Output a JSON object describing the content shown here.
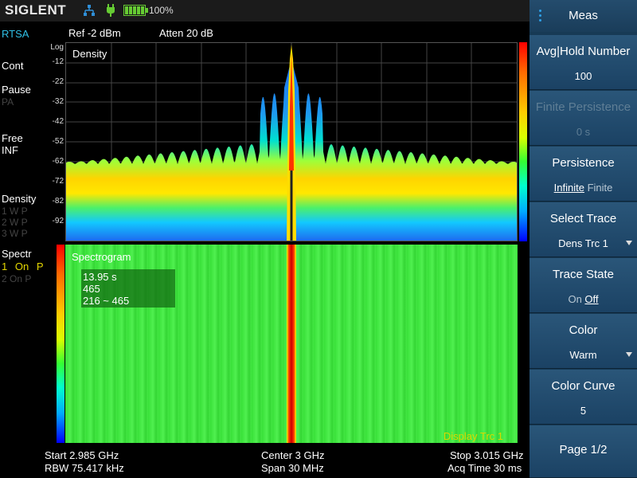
{
  "header": {
    "logo": "SIGLENT",
    "battery_percent": "100%",
    "icons": [
      "network-icon",
      "power-plug-icon",
      "battery-icon"
    ],
    "colors": {
      "logo": "#e8e8e8",
      "battery": "#66cc33",
      "network": "#2f8fd8"
    }
  },
  "left": {
    "mode": "RTSA",
    "sweep": "Cont",
    "pause": "Pause",
    "pause_sub": "PA",
    "free": "Free",
    "inf": "INF",
    "density": "Density",
    "density_traces": [
      "1 W P",
      "2 W P",
      "3 W P"
    ],
    "spectr": "Spectr",
    "spectr_trace_num": "1",
    "spectr_trace_on": "On",
    "spectr_trace_p": "P",
    "spectr_trace2": "2 On P"
  },
  "measurement": {
    "ref": "Ref  -2 dBm",
    "atten": "Atten   20 dB",
    "log_label": "Log",
    "y_ticks": [
      "-12",
      "-22",
      "-32",
      "-42",
      "-52",
      "-62",
      "-72",
      "-82",
      "-92"
    ]
  },
  "density": {
    "title": "Density"
  },
  "spectrogram": {
    "title": "Spectrogram",
    "info_time": "13.95 s",
    "info_count": "465",
    "info_range": "216 ~ 465",
    "display_trace": "Display Trc 1"
  },
  "footer": {
    "start": "Start  2.985 GHz",
    "rbw": "RBW  75.417 kHz",
    "center": "Center  3 GHz",
    "span": "Span  30 MHz",
    "stop": "Stop  3.015 GHz",
    "acq": "Acq Time   30 ms"
  },
  "menu": {
    "title": "Meas",
    "items": [
      {
        "label": "Avg|Hold Number",
        "value": "100",
        "enabled": true
      },
      {
        "label": "Finite Persistence",
        "value": "0 s",
        "enabled": false
      },
      {
        "label": "Persistence",
        "opt_on": "Infinite",
        "opt_off": "Finite"
      },
      {
        "label": "Select Trace",
        "value": "Dens Trc 1",
        "dropdown": true
      },
      {
        "label": "Trace State",
        "opt_off": "On",
        "opt_on": "Off"
      },
      {
        "label": "Color",
        "value": "Warm",
        "dropdown": true
      },
      {
        "label": "Color Curve",
        "value": "5"
      },
      {
        "label": "Page 1/2"
      }
    ]
  }
}
